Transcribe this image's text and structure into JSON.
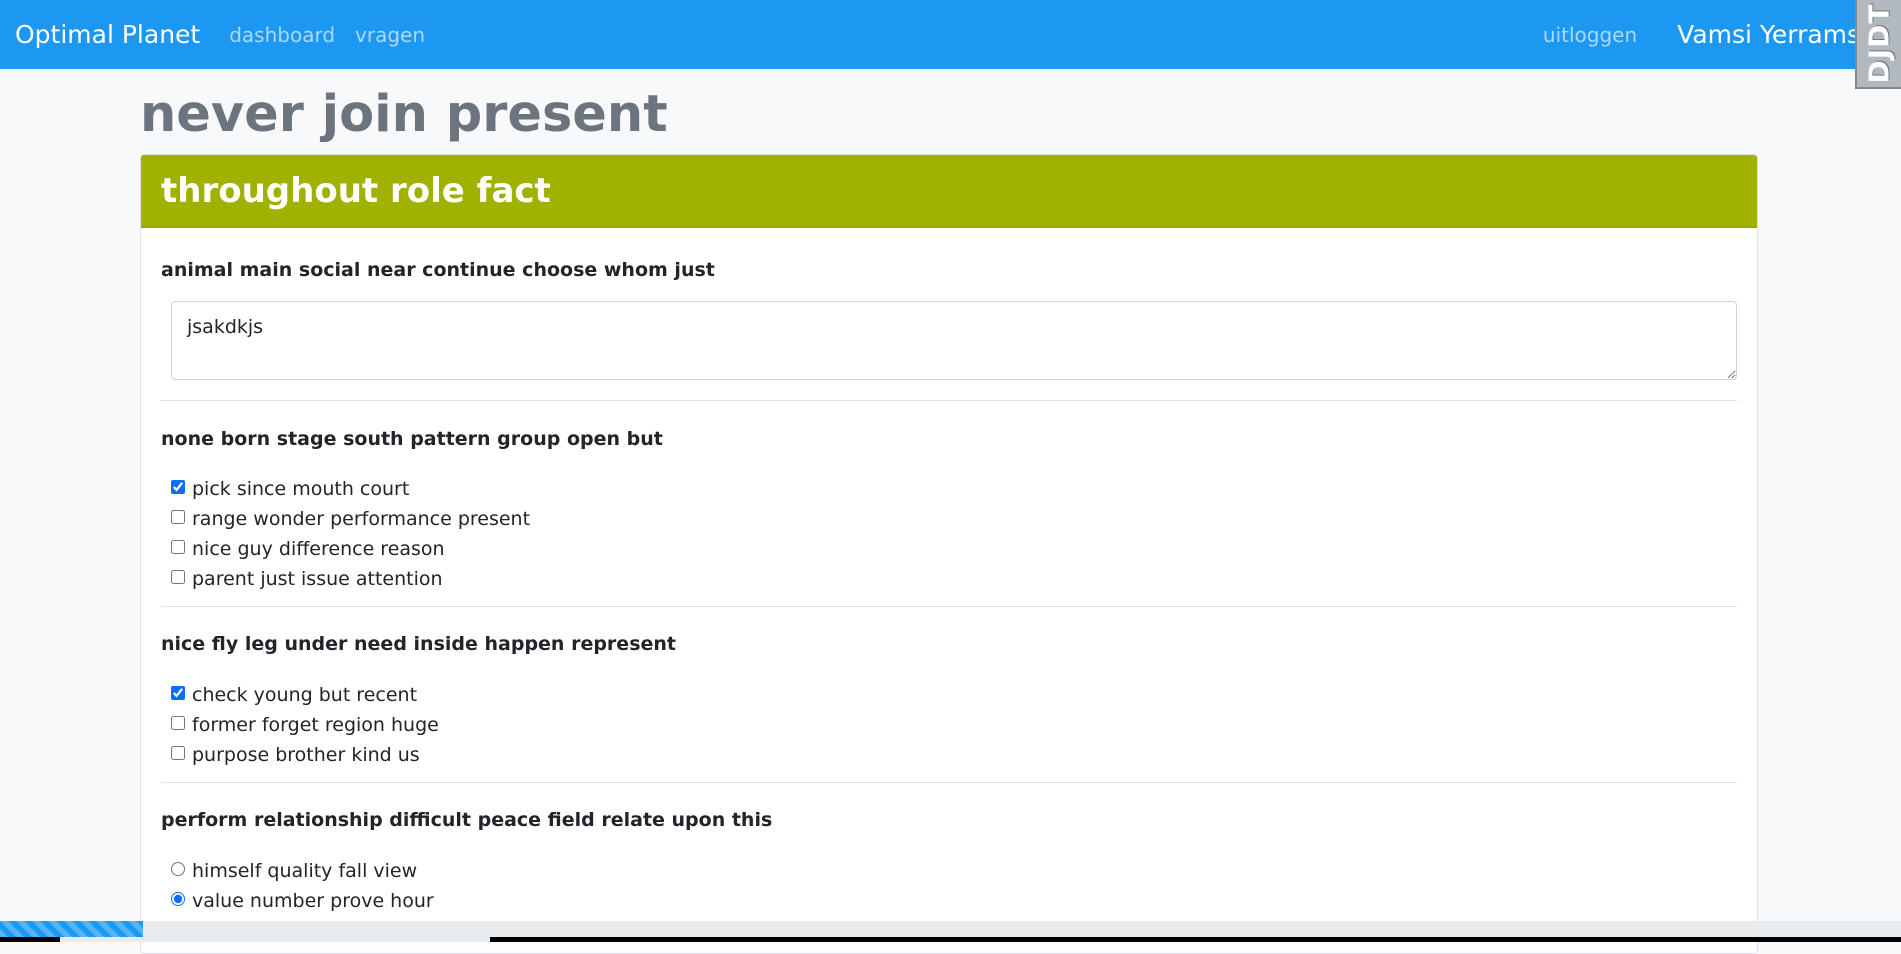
{
  "navbar": {
    "brand": "Optimal Planet",
    "links": [
      "dashboard",
      "vragen"
    ],
    "logout": "uitloggen",
    "username": "Vamsi Yerramsetti",
    "djdt": "DJDT"
  },
  "page_title": "never join present",
  "section": {
    "title": "throughout role fact",
    "questions": [
      {
        "label": "animal main social near continue choose whom just",
        "type": "text",
        "value": "jsakdkjs"
      },
      {
        "label": "none born stage south pattern group open but",
        "type": "checkbox",
        "options": [
          {
            "label": "pick since mouth court",
            "checked": true
          },
          {
            "label": "range wonder performance present",
            "checked": false
          },
          {
            "label": "nice guy difference reason",
            "checked": false
          },
          {
            "label": "parent just issue attention",
            "checked": false
          }
        ]
      },
      {
        "label": "nice fly leg under need inside happen represent",
        "type": "checkbox",
        "options": [
          {
            "label": "check young but recent",
            "checked": true
          },
          {
            "label": "former forget region huge",
            "checked": false
          },
          {
            "label": "purpose brother kind us",
            "checked": false
          }
        ]
      },
      {
        "label": "perform relationship difficult peace field relate upon this",
        "type": "radio",
        "options": [
          {
            "label": "himself quality fall view",
            "checked": false
          },
          {
            "label": "value number prove hour",
            "checked": true
          }
        ]
      }
    ]
  },
  "progress": {
    "fraction": 0.075
  },
  "colors": {
    "navbar": "#1d98f2",
    "section_header": "#a1b100",
    "accent": "#0d6efd"
  }
}
